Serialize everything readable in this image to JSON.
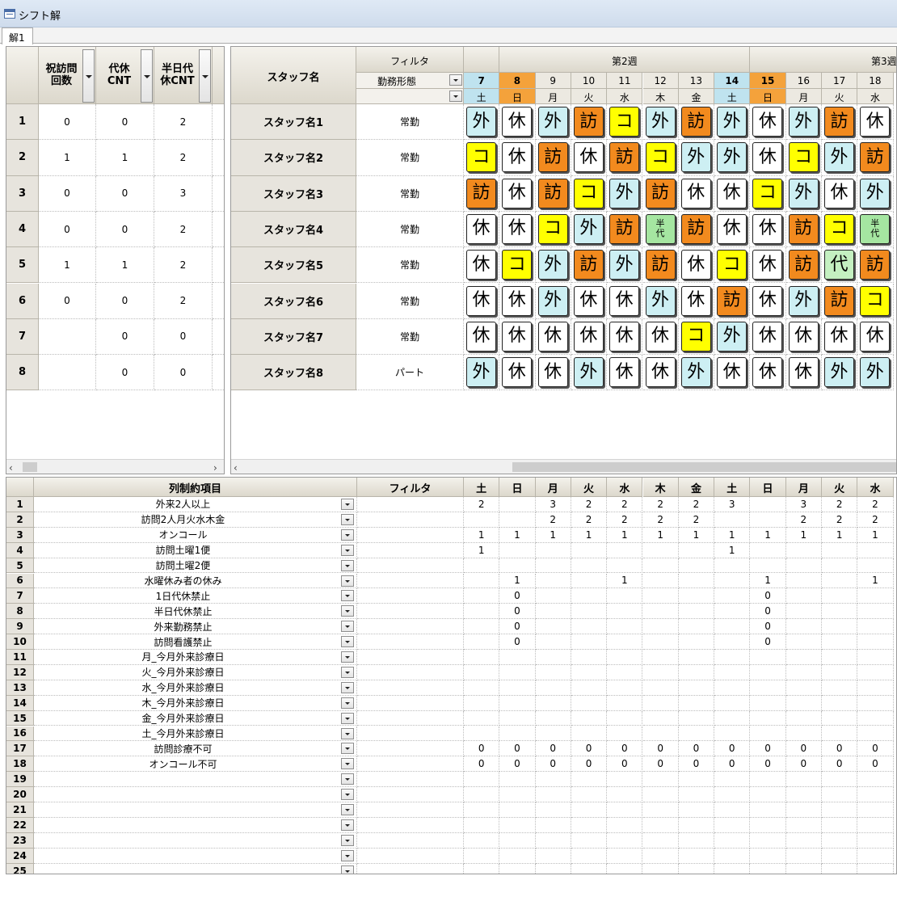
{
  "window": {
    "title": "シフト解",
    "tab": "解1"
  },
  "left_grid": {
    "headers": [
      {
        "label": "祝訪問\n回数",
        "has_dropdown": true
      },
      {
        "label": "代休\nCNT",
        "has_dropdown": true
      },
      {
        "label": "半日代\n休CNT",
        "has_dropdown": true
      }
    ],
    "rows": [
      {
        "num": "1",
        "values": [
          "0",
          "0",
          "2"
        ]
      },
      {
        "num": "2",
        "values": [
          "1",
          "1",
          "2"
        ]
      },
      {
        "num": "3",
        "values": [
          "0",
          "0",
          "3"
        ]
      },
      {
        "num": "4",
        "values": [
          "0",
          "0",
          "2"
        ]
      },
      {
        "num": "5",
        "values": [
          "1",
          "1",
          "2"
        ]
      },
      {
        "num": "6",
        "values": [
          "0",
          "0",
          "2"
        ]
      },
      {
        "num": "7",
        "values": [
          "",
          "0",
          "0"
        ]
      },
      {
        "num": "8",
        "values": [
          "",
          "0",
          "0"
        ]
      }
    ]
  },
  "schedule": {
    "staff_header": "スタッフ名",
    "filter_header": "フィルタ",
    "filter_value": "勤務形態",
    "weeks": [
      {
        "label": "第2週"
      },
      {
        "label": "第3週"
      }
    ],
    "days": [
      {
        "d": "7",
        "w": "土",
        "kind": "sat"
      },
      {
        "d": "8",
        "w": "日",
        "kind": "sun"
      },
      {
        "d": "9",
        "w": "月",
        "kind": "wk"
      },
      {
        "d": "10",
        "w": "火",
        "kind": "wk"
      },
      {
        "d": "11",
        "w": "水",
        "kind": "wk"
      },
      {
        "d": "12",
        "w": "木",
        "kind": "wk"
      },
      {
        "d": "13",
        "w": "金",
        "kind": "wk"
      },
      {
        "d": "14",
        "w": "土",
        "kind": "sat"
      },
      {
        "d": "15",
        "w": "日",
        "kind": "sun"
      },
      {
        "d": "16",
        "w": "月",
        "kind": "wk"
      },
      {
        "d": "17",
        "w": "火",
        "kind": "wk"
      },
      {
        "d": "18",
        "w": "水",
        "kind": "wk"
      }
    ],
    "staff": [
      {
        "name": "スタッフ名1",
        "type": "常勤",
        "shifts": [
          "外",
          "休",
          "外",
          "訪",
          "コ",
          "外",
          "訪",
          "外",
          "休",
          "外",
          "訪",
          "休"
        ]
      },
      {
        "name": "スタッフ名2",
        "type": "常勤",
        "shifts": [
          "コ",
          "休",
          "訪",
          "休",
          "訪",
          "コ",
          "外",
          "外",
          "休",
          "コ",
          "外",
          "訪"
        ]
      },
      {
        "name": "スタッフ名3",
        "type": "常勤",
        "shifts": [
          "訪",
          "休",
          "訪",
          "コ",
          "外",
          "訪",
          "休",
          "休",
          "コ",
          "外",
          "休",
          "外"
        ]
      },
      {
        "name": "スタッフ名4",
        "type": "常勤",
        "shifts": [
          "休",
          "休",
          "コ",
          "外",
          "訪",
          "半代",
          "訪",
          "休",
          "休",
          "訪",
          "コ",
          "半代"
        ]
      },
      {
        "name": "スタッフ名5",
        "type": "常勤",
        "shifts": [
          "休",
          "コ",
          "外",
          "訪",
          "外",
          "訪",
          "休",
          "コ",
          "休",
          "訪",
          "代",
          "訪"
        ]
      },
      {
        "name": "スタッフ名6",
        "type": "常勤",
        "shifts": [
          "休",
          "休",
          "外",
          "休",
          "休",
          "外",
          "休",
          "訪",
          "休",
          "外",
          "訪",
          "コ"
        ]
      },
      {
        "name": "スタッフ名7",
        "type": "常勤",
        "shifts": [
          "休",
          "休",
          "休",
          "休",
          "休",
          "休",
          "コ",
          "外",
          "休",
          "休",
          "休",
          "休"
        ]
      },
      {
        "name": "スタッフ名8",
        "type": "パート",
        "shifts": [
          "外",
          "休",
          "休",
          "外",
          "休",
          "休",
          "外",
          "休",
          "休",
          "休",
          "外",
          "外"
        ]
      }
    ],
    "shift_colors": {
      "外": "#cdeff3",
      "休": "#ffffff",
      "訪": "#f28a1e",
      "コ": "#ffff00",
      "半代": "#a5e6a1",
      "代": "#c4f0c1"
    },
    "day_colors": {
      "sat": "#bfe3ef",
      "sun": "#f4a23b",
      "wk": "#ece9e1"
    }
  },
  "constraints": {
    "name_header": "列制約項目",
    "filter_header": "フィルタ",
    "day_headers": [
      "土",
      "日",
      "月",
      "火",
      "水",
      "木",
      "金",
      "土",
      "日",
      "月",
      "火",
      "水"
    ],
    "rows": [
      {
        "num": "1",
        "label": "外来2人以上",
        "values": [
          "2",
          "",
          "3",
          "2",
          "2",
          "2",
          "2",
          "3",
          "",
          "3",
          "2",
          "2"
        ]
      },
      {
        "num": "2",
        "label": "訪問2人月火水木金",
        "values": [
          "",
          "",
          "2",
          "2",
          "2",
          "2",
          "2",
          "",
          "",
          "2",
          "2",
          "2"
        ]
      },
      {
        "num": "3",
        "label": "オンコール",
        "values": [
          "1",
          "1",
          "1",
          "1",
          "1",
          "1",
          "1",
          "1",
          "1",
          "1",
          "1",
          "1"
        ]
      },
      {
        "num": "4",
        "label": "訪問土曜1便",
        "values": [
          "1",
          "",
          "",
          "",
          "",
          "",
          "",
          "1",
          "",
          "",
          "",
          ""
        ]
      },
      {
        "num": "5",
        "label": "訪問土曜2便",
        "values": [
          "",
          "",
          "",
          "",
          "",
          "",
          "",
          "",
          "",
          "",
          "",
          ""
        ]
      },
      {
        "num": "6",
        "label": "水曜休み者の休み",
        "values": [
          "",
          "1",
          "",
          "",
          "1",
          "",
          "",
          "",
          "1",
          "",
          "",
          "1"
        ]
      },
      {
        "num": "7",
        "label": "1日代休禁止",
        "values": [
          "",
          "0",
          "",
          "",
          "",
          "",
          "",
          "",
          "0",
          "",
          "",
          ""
        ]
      },
      {
        "num": "8",
        "label": "半日代休禁止",
        "values": [
          "",
          "0",
          "",
          "",
          "",
          "",
          "",
          "",
          "0",
          "",
          "",
          ""
        ]
      },
      {
        "num": "9",
        "label": "外来勤務禁止",
        "values": [
          "",
          "0",
          "",
          "",
          "",
          "",
          "",
          "",
          "0",
          "",
          "",
          ""
        ]
      },
      {
        "num": "10",
        "label": "訪問看護禁止",
        "values": [
          "",
          "0",
          "",
          "",
          "",
          "",
          "",
          "",
          "0",
          "",
          "",
          ""
        ]
      },
      {
        "num": "11",
        "label": "月_今月外来診療日",
        "values": [
          "",
          "",
          "",
          "",
          "",
          "",
          "",
          "",
          "",
          "",
          "",
          ""
        ]
      },
      {
        "num": "12",
        "label": "火_今月外来診療日",
        "values": [
          "",
          "",
          "",
          "",
          "",
          "",
          "",
          "",
          "",
          "",
          "",
          ""
        ]
      },
      {
        "num": "13",
        "label": "水_今月外来診療日",
        "values": [
          "",
          "",
          "",
          "",
          "",
          "",
          "",
          "",
          "",
          "",
          "",
          ""
        ]
      },
      {
        "num": "14",
        "label": "木_今月外来診療日",
        "values": [
          "",
          "",
          "",
          "",
          "",
          "",
          "",
          "",
          "",
          "",
          "",
          ""
        ]
      },
      {
        "num": "15",
        "label": "金_今月外来診療日",
        "values": [
          "",
          "",
          "",
          "",
          "",
          "",
          "",
          "",
          "",
          "",
          "",
          ""
        ]
      },
      {
        "num": "16",
        "label": "土_今月外来診療日",
        "values": [
          "",
          "",
          "",
          "",
          "",
          "",
          "",
          "",
          "",
          "",
          "",
          ""
        ]
      },
      {
        "num": "17",
        "label": "訪問診療不可",
        "values": [
          "0",
          "0",
          "0",
          "0",
          "0",
          "0",
          "0",
          "0",
          "0",
          "0",
          "0",
          "0"
        ]
      },
      {
        "num": "18",
        "label": "オンコール不可",
        "values": [
          "0",
          "0",
          "0",
          "0",
          "0",
          "0",
          "0",
          "0",
          "0",
          "0",
          "0",
          "0"
        ]
      },
      {
        "num": "19",
        "label": "",
        "values": []
      },
      {
        "num": "20",
        "label": "",
        "values": []
      },
      {
        "num": "21",
        "label": "",
        "values": []
      },
      {
        "num": "22",
        "label": "",
        "values": []
      },
      {
        "num": "23",
        "label": "",
        "values": []
      },
      {
        "num": "24",
        "label": "",
        "values": []
      },
      {
        "num": "25",
        "label": "",
        "values": []
      }
    ]
  },
  "scroll": {
    "left_arrow": "‹",
    "right_arrow": "›"
  }
}
